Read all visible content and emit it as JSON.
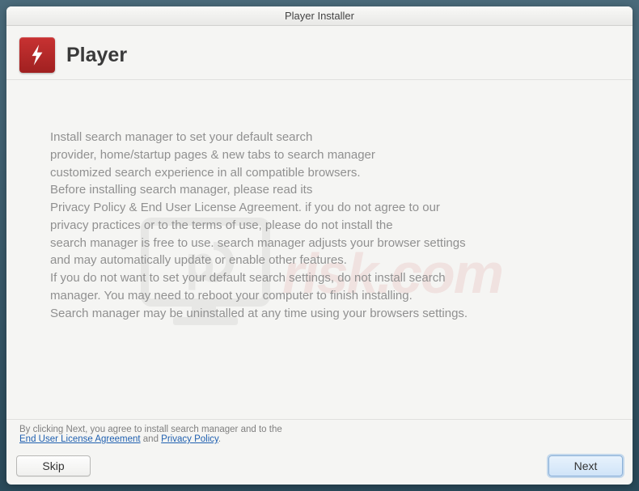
{
  "window": {
    "title": "Player Installer"
  },
  "header": {
    "title": "Player",
    "icon": "flash-icon"
  },
  "body_text": "Install search manager to set your default search\nprovider, home/startup pages & new tabs to search manager\ncustomized search experience in all compatible browsers.\nBefore installing search manager, please read its\nPrivacy Policy & End User License Agreement. if you do not agree to our\nprivacy practices or to the terms of use, please do not install the\nsearch manager is free to use. search manager adjusts your browser settings\nand may automatically update or enable other features.\nIf you do not want to set your default search settings, do not install search\nmanager. You may need to reboot your computer to finish installing.\nSearch manager may be uninstalled at any time using your browsers settings.",
  "agree": {
    "prefix": "By clicking Next, you agree to install search manager and to the",
    "link_eula": "End User License Agreement",
    "joiner": " and ",
    "link_privacy": "Privacy Policy",
    "suffix": "."
  },
  "buttons": {
    "skip": "Skip",
    "next": "Next"
  },
  "watermark": {
    "text": "risk.com"
  }
}
